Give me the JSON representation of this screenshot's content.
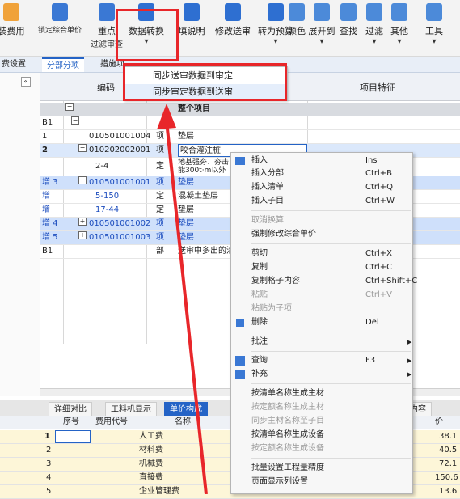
{
  "toolbar": {
    "items": [
      {
        "label": "装费用",
        "sub": ""
      },
      {
        "label": "锁定综合单价",
        "sub": ""
      },
      {
        "label": "重点",
        "sub": "过滤审查"
      },
      {
        "label": "数据转换",
        "sub": ""
      },
      {
        "label": "填说明",
        "sub": ""
      },
      {
        "label": "修改送审",
        "sub": ""
      },
      {
        "label": "转为预算",
        "sub": ""
      },
      {
        "label": "颜色",
        "sub": ""
      },
      {
        "label": "展开到",
        "sub": ""
      },
      {
        "label": "查找",
        "sub": ""
      },
      {
        "label": "过滤",
        "sub": ""
      },
      {
        "label": "其他",
        "sub": ""
      },
      {
        "label": "工具",
        "sub": ""
      }
    ]
  },
  "tabs": [
    "费设置",
    "分部分项",
    "措施项"
  ],
  "dropdown": {
    "items": [
      "同步送审数据到审定",
      "同步审定数据到送审"
    ]
  },
  "grid": {
    "headers": {
      "code": "编码",
      "feature": "项目特征"
    },
    "rows": [
      {
        "num": "",
        "code": "",
        "type": "",
        "name": "整个项目",
        "style": "group"
      },
      {
        "num": "B1",
        "code": "",
        "type": "",
        "name": "",
        "style": "normal"
      },
      {
        "num": "1",
        "code": "010501001004",
        "type": "项",
        "name": "垫层",
        "style": "normal"
      },
      {
        "num": "2",
        "code": "010202002001",
        "type": "项",
        "name": "咬合灌注桩",
        "style": "sel"
      },
      {
        "num": "",
        "code": "2-4",
        "type": "定",
        "name": "地基强夯、夯击能300t·m以外",
        "style": "normal"
      },
      {
        "num": "增 3",
        "code": "010501001001",
        "type": "项",
        "name": "垫层",
        "style": "blue"
      },
      {
        "num": "增",
        "code": "5-150",
        "type": "定",
        "name": "混凝土垫层",
        "style": "normal"
      },
      {
        "num": "增",
        "code": "17-44",
        "type": "定",
        "name": "垫层",
        "style": "normal"
      },
      {
        "num": "增 4",
        "code": "010501001002",
        "type": "项",
        "name": "垫层",
        "style": "blue"
      },
      {
        "num": "增 5",
        "code": "010501001003",
        "type": "项",
        "name": "垫层",
        "style": "blue"
      },
      {
        "num": "B1",
        "code": "",
        "type": "部",
        "name": "送审中多出的清单",
        "style": "normal"
      }
    ]
  },
  "context_menu": {
    "items": [
      {
        "label": "插入",
        "shortcut": "Ins",
        "disabled": false,
        "icon": "insert-icon"
      },
      {
        "label": "插入分部",
        "shortcut": "Ctrl+B",
        "disabled": false
      },
      {
        "label": "插入清单",
        "shortcut": "Ctrl+Q",
        "disabled": false
      },
      {
        "label": "插入子目",
        "shortcut": "Ctrl+W",
        "disabled": false
      },
      {
        "label": "取消换算",
        "shortcut": "",
        "disabled": true
      },
      {
        "label": "强制修改综合单价",
        "shortcut": "",
        "disabled": false
      },
      {
        "label": "剪切",
        "shortcut": "Ctrl+X",
        "disabled": false
      },
      {
        "label": "复制",
        "shortcut": "Ctrl+C",
        "disabled": false
      },
      {
        "label": "复制格子内容",
        "shortcut": "Ctrl+Shift+C",
        "disabled": false
      },
      {
        "label": "粘贴",
        "shortcut": "Ctrl+V",
        "disabled": true
      },
      {
        "label": "粘贴为子项",
        "shortcut": "",
        "disabled": true
      },
      {
        "label": "删除",
        "shortcut": "Del",
        "disabled": false,
        "icon": "delete-icon"
      },
      {
        "label": "批注",
        "shortcut": "",
        "disabled": false,
        "submenu": true
      },
      {
        "label": "查询",
        "shortcut": "F3",
        "disabled": false,
        "submenu": true,
        "icon": "query-icon"
      },
      {
        "label": "补充",
        "shortcut": "",
        "disabled": false,
        "submenu": true,
        "icon": "supplement-icon"
      },
      {
        "label": "按清单名称生成主材",
        "shortcut": "",
        "disabled": false
      },
      {
        "label": "按定额名称生成主材",
        "shortcut": "",
        "disabled": true
      },
      {
        "label": "同步主材名称至子目",
        "shortcut": "",
        "disabled": true
      },
      {
        "label": "按清单名称生成设备",
        "shortcut": "",
        "disabled": false
      },
      {
        "label": "按定额名称生成设备",
        "shortcut": "",
        "disabled": true
      },
      {
        "label": "批量设置工程量精度",
        "shortcut": "",
        "disabled": false
      },
      {
        "label": "页面显示列设置",
        "shortcut": "",
        "disabled": false
      }
    ]
  },
  "bottom": {
    "tabs": [
      "详细对比",
      "工料机显示",
      "单价构成",
      "内容"
    ],
    "headers": [
      "序号",
      "费用代号",
      "名称",
      "价"
    ],
    "rows": [
      {
        "num": "1",
        "name": "人工费",
        "value": "38.1"
      },
      {
        "num": "2",
        "name": "材料费",
        "value": "40.5"
      },
      {
        "num": "3",
        "name": "机械费",
        "value": "72.1"
      },
      {
        "num": "4",
        "name": "直接费",
        "value": "150.6"
      },
      {
        "num": "5",
        "name": "企业管理费",
        "value": "13.6"
      }
    ]
  },
  "colors": {
    "accent": "#2463c6",
    "annotation_red": "#e8262a",
    "selected_row": "#dbe8fb"
  }
}
